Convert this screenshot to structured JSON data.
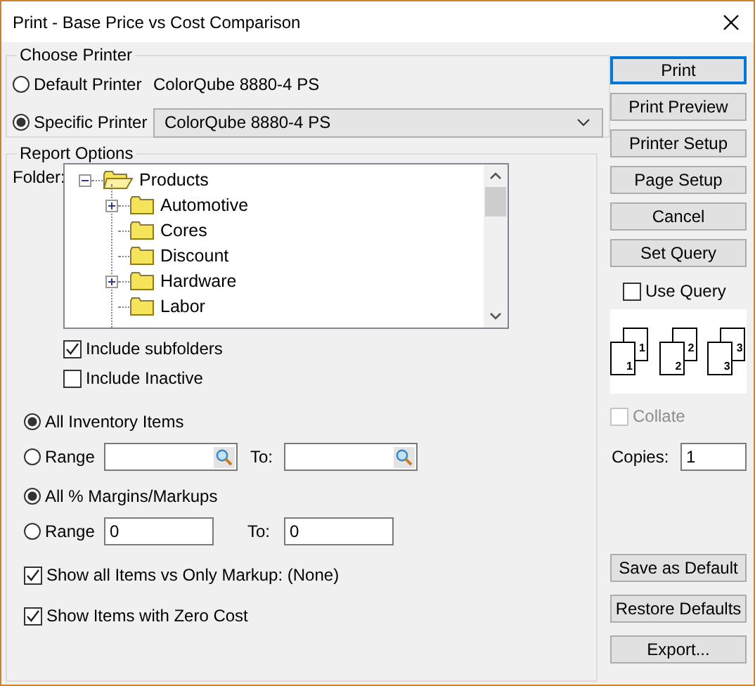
{
  "window": {
    "title": "Print - Base Price vs Cost Comparison"
  },
  "choose_printer": {
    "title": "Choose Printer",
    "options": [
      {
        "label": "Default Printer",
        "selected": false
      },
      {
        "label": "Specific Printer",
        "selected": true
      }
    ],
    "default_printer": "ColorQube 8880-4 PS",
    "printer_select": {
      "value": "ColorQube 8880-4 PS"
    }
  },
  "report_options": {
    "title": "Report Options",
    "folder_label": "Folder:",
    "tree": {
      "label": "Products",
      "expanded": true,
      "children": [
        {
          "label": "Automotive",
          "expandable": true
        },
        {
          "label": "Cores",
          "expandable": false
        },
        {
          "label": "Discount",
          "expandable": false
        },
        {
          "label": "Hardware",
          "expandable": true
        },
        {
          "label": "Labor",
          "expandable": false
        }
      ]
    },
    "include": [
      {
        "label": "Include subfolders",
        "checked": true
      },
      {
        "label": "Include Inactive",
        "checked": false
      }
    ],
    "inventory": {
      "options": [
        {
          "label": "All Inventory Items",
          "selected": true
        },
        {
          "label": "Range",
          "selected": false
        }
      ],
      "to_label": "To:"
    },
    "margins": {
      "options": [
        {
          "label": "All % Margins/Markups",
          "selected": true
        },
        {
          "label": "Range",
          "selected": false
        }
      ],
      "from": {
        "value": "0"
      },
      "to_label": "To:",
      "to": {
        "value": "0"
      }
    },
    "show_options": [
      {
        "label": "Show all Items vs Only Markup: (None)",
        "checked": true
      },
      {
        "label": "Show Items with Zero Cost",
        "checked": true
      }
    ]
  },
  "actions": [
    {
      "label": "Print",
      "focused": true
    },
    {
      "label": "Print Preview",
      "focused": false
    },
    {
      "label": "Printer Setup",
      "focused": false
    },
    {
      "label": "Page Setup",
      "focused": false
    },
    {
      "label": "Cancel",
      "focused": false
    },
    {
      "label": "Set Query",
      "focused": false
    }
  ],
  "use_query": {
    "label": "Use Query",
    "checked": false
  },
  "collate_pages": [
    {
      "back": "1",
      "front": "1"
    },
    {
      "back": "2",
      "front": "2"
    },
    {
      "back": "3",
      "front": "3"
    }
  ],
  "collate": {
    "label": "Collate",
    "checked": false,
    "disabled": true
  },
  "copies": {
    "label": "Copies:",
    "value": "1"
  },
  "footer_buttons": [
    {
      "label": "Save as Default"
    },
    {
      "label": "Restore Defaults"
    },
    {
      "label": "Export..."
    }
  ]
}
